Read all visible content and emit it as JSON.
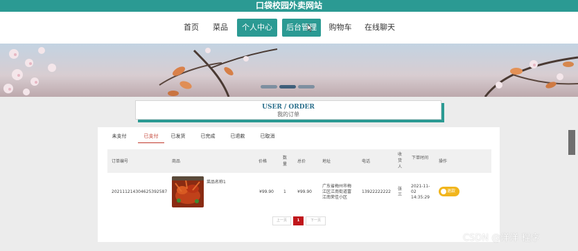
{
  "site": {
    "title": "口袋校园外卖网站"
  },
  "nav": {
    "items": [
      {
        "label": "首页",
        "active": false
      },
      {
        "label": "菜品",
        "active": false
      },
      {
        "label": "个人中心",
        "active": true
      },
      {
        "label": "后台管理",
        "active": true
      },
      {
        "label": "购物车",
        "active": false
      },
      {
        "label": "在线聊天",
        "active": false
      }
    ]
  },
  "section": {
    "title_en": "USER / ORDER",
    "title_cn": "我的订单"
  },
  "order_tabs": {
    "items": [
      {
        "label": "未支付",
        "active": false
      },
      {
        "label": "已支付",
        "active": true
      },
      {
        "label": "已发货",
        "active": false
      },
      {
        "label": "已完成",
        "active": false
      },
      {
        "label": "已退款",
        "active": false
      },
      {
        "label": "已取消",
        "active": false
      }
    ]
  },
  "table": {
    "headers": {
      "order_no": "订单编号",
      "product": "商品",
      "price": "价格",
      "qty": "数量",
      "total": "总价",
      "address": "地址",
      "phone": "电话",
      "receiver": "收货人",
      "order_time": "下单时间",
      "action": "操作"
    },
    "rows": [
      {
        "order_no": "202111214304625392587",
        "product_name": "菜品名称1",
        "price": "¥99.90",
        "qty": "1",
        "total": "¥99.90",
        "address": "广东省梅州市梅江区江南街道富江南荣佳小区",
        "phone": "13922222222",
        "receiver": "张三",
        "order_time": "2021-11-02 14:35:29",
        "action_label": "退款"
      }
    ]
  },
  "pagination": {
    "prev": "上一页",
    "current": "1",
    "next": "下一页"
  },
  "watermark": "CSDN @洋洋  程序",
  "colors": {
    "primary": "#2b9a93",
    "accent": "#c0161b",
    "button": "#f1b51c"
  }
}
